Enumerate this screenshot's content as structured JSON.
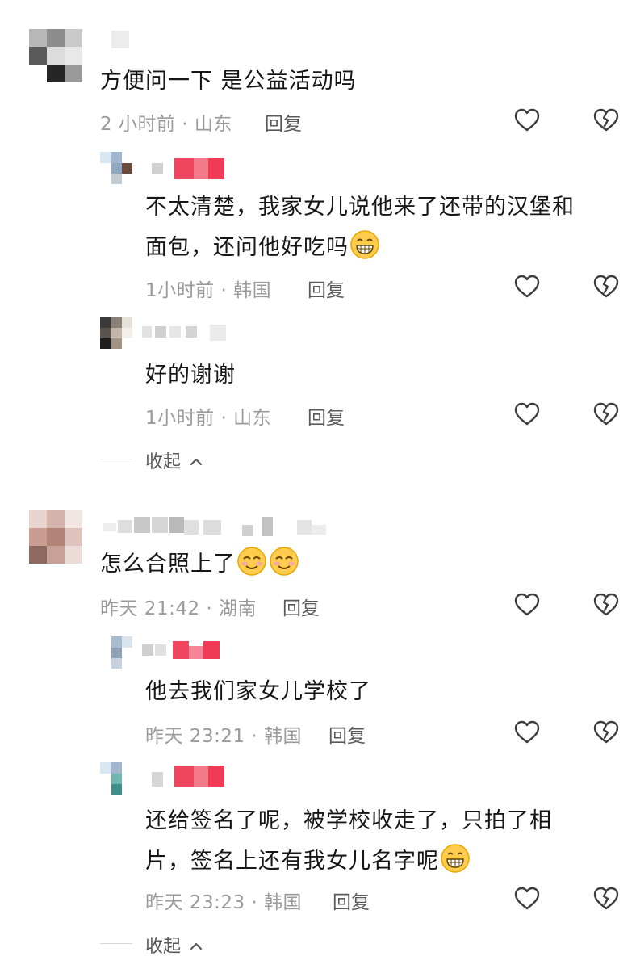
{
  "icons": {
    "like": "heart-outline-icon",
    "dislike": "broken-heart-icon",
    "chevron": "chevron-up-icon",
    "grin": "grinning-face-emoji",
    "smile": "smiling-face-emoji"
  },
  "thread1": {
    "comment": {
      "text": "方便问一下 是公益活动吗",
      "time": "2 小时前 · 山东",
      "reply": "回复"
    },
    "reply1": {
      "line1": "不太清楚，我家女儿说他来了还带的汉堡和",
      "line2": "面包，还问他好吃吗",
      "time": "1小时前 · 韩国",
      "reply": "回复"
    },
    "reply2": {
      "text": "好的谢谢",
      "time": "1小时前 · 山东",
      "reply": "回复"
    },
    "collapse": "收起"
  },
  "thread2": {
    "comment": {
      "text": "怎么合照上了",
      "time": "昨天 21:42 · 湖南",
      "reply": "回复"
    },
    "reply1": {
      "text": "他去我们家女儿学校了",
      "time": "昨天 23:21 · 韩国",
      "reply": "回复"
    },
    "reply2": {
      "line1": "还给签名了呢，被学校收走了，只拍了相",
      "line2": "片，签名上还有我女儿名字呢",
      "time": "昨天 23:23 · 韩国",
      "reply": "回复"
    },
    "collapse": "收起"
  }
}
